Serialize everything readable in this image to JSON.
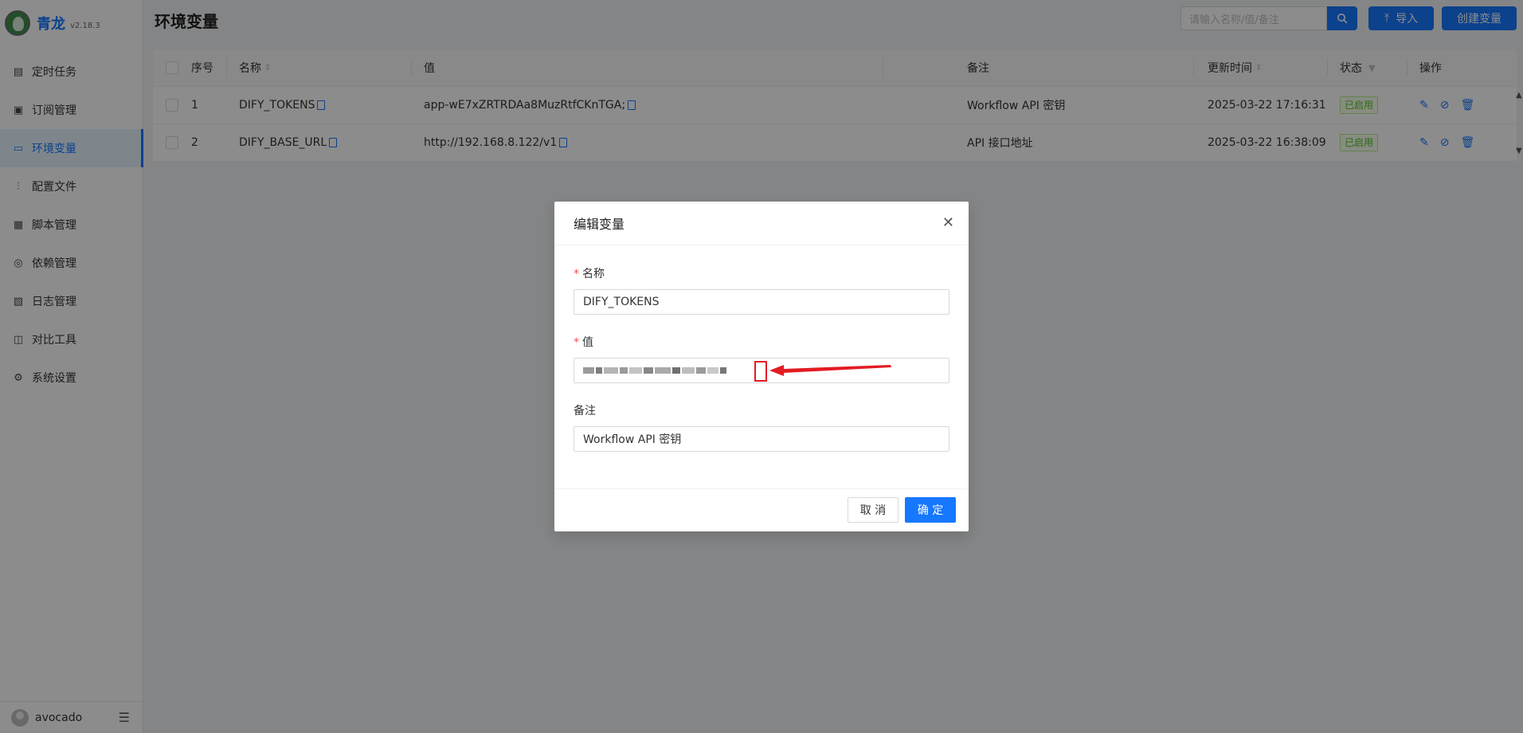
{
  "app": {
    "name": "青龙",
    "version": "v2.18.3"
  },
  "sidebar": {
    "items": [
      {
        "label": "定时任务",
        "icon": "calendar-icon"
      },
      {
        "label": "订阅管理",
        "icon": "subscription-icon"
      },
      {
        "label": "环境变量",
        "icon": "monitor-icon",
        "active": true
      },
      {
        "label": "配置文件",
        "icon": "sliders-icon"
      },
      {
        "label": "脚本管理",
        "icon": "script-icon"
      },
      {
        "label": "依赖管理",
        "icon": "dependency-icon"
      },
      {
        "label": "日志管理",
        "icon": "log-icon"
      },
      {
        "label": "对比工具",
        "icon": "diff-icon"
      },
      {
        "label": "系统设置",
        "icon": "gear-icon"
      }
    ],
    "user": "avocado"
  },
  "header": {
    "title": "环境变量",
    "search_placeholder": "请输入名称/值/备注",
    "import_label": "导入",
    "create_label": "创建变量"
  },
  "table": {
    "columns": [
      "序号",
      "名称",
      "值",
      "备注",
      "更新时间",
      "状态",
      "操作"
    ],
    "rows": [
      {
        "index": "1",
        "name": "DIFY_TOKENS",
        "value": "app-wE7xZRTRDAa8MuzRtfCKnTGA;",
        "remark": "Workflow API 密钥",
        "updated": "2025-03-22 17:16:31",
        "status": "已启用"
      },
      {
        "index": "2",
        "name": "DIFY_BASE_URL",
        "value": "http://192.168.8.122/v1",
        "remark": "API 接口地址",
        "updated": "2025-03-22 16:38:09",
        "status": "已启用"
      }
    ]
  },
  "modal": {
    "title": "编辑变量",
    "name_label": "名称",
    "name_value": "DIFY_TOKENS",
    "value_label": "值",
    "remark_label": "备注",
    "remark_value": "Workflow API 密钥",
    "cancel_label": "取 消",
    "ok_label": "确 定"
  },
  "colors": {
    "primary": "#1677ff",
    "success": "#52c41a",
    "annotation": "#e31b23"
  }
}
